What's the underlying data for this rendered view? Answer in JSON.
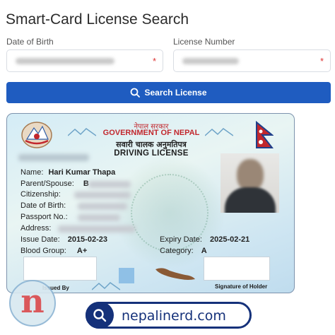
{
  "page": {
    "title": "Smart-Card License Search"
  },
  "form": {
    "dob_label": "Date of Birth",
    "license_label": "License Number",
    "required_mark": "*",
    "search_button": "Search License"
  },
  "card": {
    "header_nepali": "नेपाल सरकार",
    "government": "GOVERNMENT OF NEPAL",
    "dept_nepali": "सवारी चालक अनुमतिपत्र",
    "card_type": "DRIVING LICENSE",
    "fields": {
      "name_label": "Name:",
      "name_value": "Hari Kumar Thapa",
      "parent_label": "Parent/Spouse:",
      "parent_value_partial": "B",
      "citizenship_label": "Citizenship:",
      "dob_label": "Date of Birth:",
      "passport_label": "Passport No.:",
      "address_label": "Address:",
      "issue_label": "Issue Date:",
      "issue_value": "2015-02-23",
      "expiry_label": "Expiry Date:",
      "expiry_value": "2025-02-21",
      "blood_label": "Blood Group:",
      "blood_value": "A+",
      "category_label": "Category:",
      "category_value": "A"
    },
    "issued_by": "Issued By",
    "signature_of_holder": "Signature of Holder"
  },
  "watermark": {
    "logo_letter": "n",
    "site": "nepalinerd.com"
  },
  "colors": {
    "accent": "#1f5cc0",
    "government_red": "#c2272d",
    "brand_navy": "#15317a"
  },
  "icons": [
    "search-icon",
    "emblem-icon",
    "flag-icon",
    "mountain-icon",
    "nepal-map-icon"
  ]
}
